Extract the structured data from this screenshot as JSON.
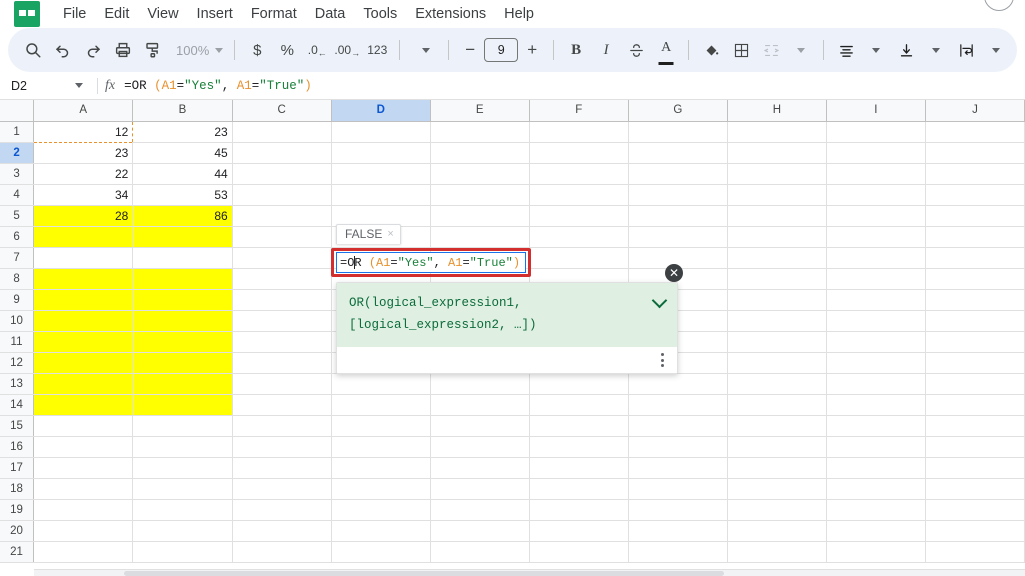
{
  "app": {
    "logo_icon": "sheets-logo",
    "menus": [
      "File",
      "Edit",
      "View",
      "Insert",
      "Format",
      "Data",
      "Tools",
      "Extensions",
      "Help"
    ]
  },
  "toolbar": {
    "search_icon": "search-icon",
    "undo_icon": "undo-icon",
    "redo_icon": "redo-icon",
    "print_icon": "print-icon",
    "paint_format_icon": "paint-format-icon",
    "zoom_value": "100%",
    "currency_label": "$",
    "percent_label": "%",
    "decrease_decimal_label": ".0",
    "increase_decimal_label": ".00",
    "number_format_label": "123",
    "more_formats_icon": "chevron-down-icon",
    "font_size_decrease": "−",
    "font_size_value": "9",
    "font_size_increase": "+",
    "bold_label": "B",
    "italic_label": "I",
    "strikethrough_icon": "strikethrough-icon",
    "text_color_label": "A",
    "fill_color_icon": "fill-color-icon",
    "borders_icon": "borders-icon",
    "merge_cells_icon": "merge-cells-icon",
    "horizontal_align_icon": "horizontal-align-icon",
    "vertical_align_icon": "vertical-align-icon",
    "text_wrap_icon": "text-wrap-icon"
  },
  "formula_bar": {
    "name_box_value": "D2",
    "name_box_caret_icon": "chevron-down-icon",
    "fx_label": "fx",
    "formula_prefix": "=OR ",
    "formula_open_paren": "(",
    "formula_ref1": "A1",
    "formula_eq1": "=",
    "formula_str1": "\"Yes\"",
    "formula_comma": ", ",
    "formula_ref2": "A1",
    "formula_eq2": "=",
    "formula_str2": "\"True\"",
    "formula_close_paren": ")"
  },
  "grid": {
    "columns": [
      "A",
      "B",
      "C",
      "D",
      "E",
      "F",
      "G",
      "H",
      "I",
      "J"
    ],
    "selected_column": "D",
    "selected_row": 2,
    "rows": [
      {
        "num": "1",
        "cells": [
          "12",
          "23",
          "",
          "",
          "",
          "",
          "",
          "",
          "",
          ""
        ]
      },
      {
        "num": "2",
        "cells": [
          "23",
          "45",
          "",
          "",
          "",
          "",
          "",
          "",
          "",
          ""
        ]
      },
      {
        "num": "3",
        "cells": [
          "22",
          "44",
          "",
          "",
          "",
          "",
          "",
          "",
          "",
          ""
        ]
      },
      {
        "num": "4",
        "cells": [
          "34",
          "53",
          "",
          "",
          "",
          "",
          "",
          "",
          "",
          ""
        ]
      },
      {
        "num": "5",
        "cells": [
          "28",
          "86",
          "",
          "",
          "",
          "",
          "",
          "",
          "",
          ""
        ]
      },
      {
        "num": "6",
        "cells": [
          "",
          "",
          "",
          "",
          "",
          "",
          "",
          "",
          "",
          ""
        ]
      },
      {
        "num": "7",
        "cells": [
          "",
          "",
          "",
          "",
          "",
          "",
          "",
          "",
          "",
          ""
        ]
      },
      {
        "num": "8",
        "cells": [
          "",
          "",
          "",
          "",
          "",
          "",
          "",
          "",
          "",
          ""
        ]
      },
      {
        "num": "9",
        "cells": [
          "",
          "",
          "",
          "",
          "",
          "",
          "",
          "",
          "",
          ""
        ]
      },
      {
        "num": "10",
        "cells": [
          "",
          "",
          "",
          "",
          "",
          "",
          "",
          "",
          "",
          ""
        ]
      },
      {
        "num": "11",
        "cells": [
          "",
          "",
          "",
          "",
          "",
          "",
          "",
          "",
          "",
          ""
        ]
      },
      {
        "num": "12",
        "cells": [
          "",
          "",
          "",
          "",
          "",
          "",
          "",
          "",
          "",
          ""
        ]
      },
      {
        "num": "13",
        "cells": [
          "",
          "",
          "",
          "",
          "",
          "",
          "",
          "",
          "",
          ""
        ]
      },
      {
        "num": "14",
        "cells": [
          "",
          "",
          "",
          "",
          "",
          "",
          "",
          "",
          "",
          ""
        ]
      },
      {
        "num": "15",
        "cells": [
          "",
          "",
          "",
          "",
          "",
          "",
          "",
          "",
          "",
          ""
        ]
      },
      {
        "num": "16",
        "cells": [
          "",
          "",
          "",
          "",
          "",
          "",
          "",
          "",
          "",
          ""
        ]
      },
      {
        "num": "17",
        "cells": [
          "",
          "",
          "",
          "",
          "",
          "",
          "",
          "",
          "",
          ""
        ]
      },
      {
        "num": "18",
        "cells": [
          "",
          "",
          "",
          "",
          "",
          "",
          "",
          "",
          "",
          ""
        ]
      },
      {
        "num": "19",
        "cells": [
          "",
          "",
          "",
          "",
          "",
          "",
          "",
          "",
          "",
          ""
        ]
      },
      {
        "num": "20",
        "cells": [
          "",
          "",
          "",
          "",
          "",
          "",
          "",
          "",
          "",
          ""
        ]
      },
      {
        "num": "21",
        "cells": [
          "",
          "",
          "",
          "",
          "",
          "",
          "",
          "",
          "",
          ""
        ]
      }
    ],
    "yellow_fill_rows": [
      5,
      6,
      8,
      9,
      10,
      11,
      12,
      13,
      14
    ],
    "yellow_fill_columns": [
      "A",
      "B"
    ],
    "yellow_fill_color": "#ffff00",
    "copy_marquee_cell": "A1",
    "copy_marquee_color": "#e8912d"
  },
  "cell_editor": {
    "result_tooltip": "FALSE",
    "result_tooltip_close": "×",
    "text_prefix": "=O",
    "text_suffix": "R ",
    "open_paren": "(",
    "ref1": "A1",
    "eq1": "=",
    "str1": "\"Yes\"",
    "comma": ", ",
    "ref2": "A1",
    "eq2": "=",
    "str2": "\"True\"",
    "close_paren": ")",
    "close_button": "✕",
    "highlight_color": "#d32f2f"
  },
  "help_panel": {
    "signature_line1": "OR(logical_expression1,",
    "signature_line2": "[logical_expression2, …])",
    "expand_icon": "chevron-down-icon",
    "more_options_icon": "kebab-menu-icon",
    "background_color": "#dff0e2"
  }
}
